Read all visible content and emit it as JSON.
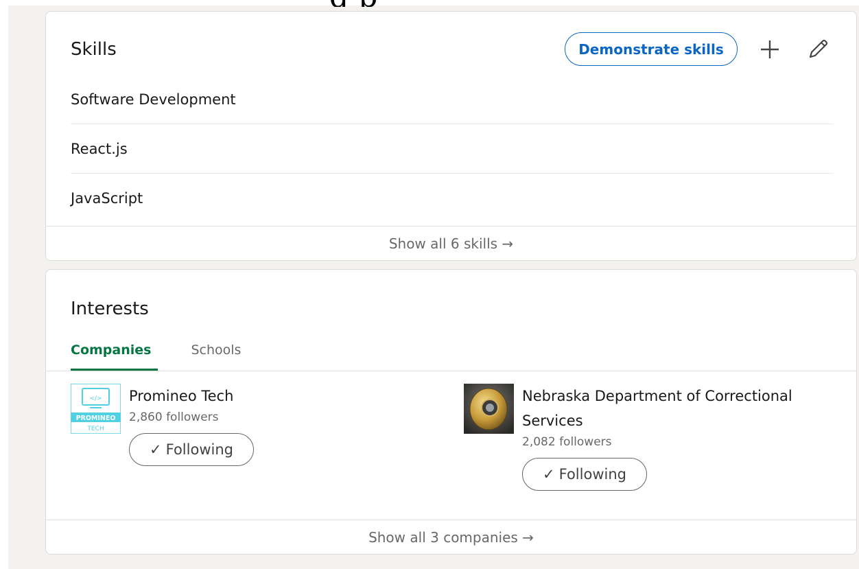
{
  "top_cutoff_text": "g                                  p",
  "skills": {
    "title": "Skills",
    "demonstrate_label": "Demonstrate skills",
    "items": [
      "Software Development",
      "React.js",
      "JavaScript"
    ],
    "show_all_label": "Show all 6 skills →"
  },
  "interests": {
    "title": "Interests",
    "tabs": [
      {
        "label": "Companies",
        "active": true
      },
      {
        "label": "Schools",
        "active": false
      }
    ],
    "companies": [
      {
        "name": "Promineo Tech",
        "followers": "2,860 followers",
        "follow_label": "Following",
        "logo": "promineo-logo",
        "logo_text": "PROMINEO TECH"
      },
      {
        "name": "Nebraska Department of Correctional Services",
        "followers": "2,082 followers",
        "follow_label": "Following",
        "logo": "badge-logo"
      }
    ],
    "show_all_label": "Show all 3 companies →"
  },
  "colors": {
    "brand_blue": "#0a66c2",
    "active_green": "#057642",
    "page_bg": "#f4f2ee"
  }
}
